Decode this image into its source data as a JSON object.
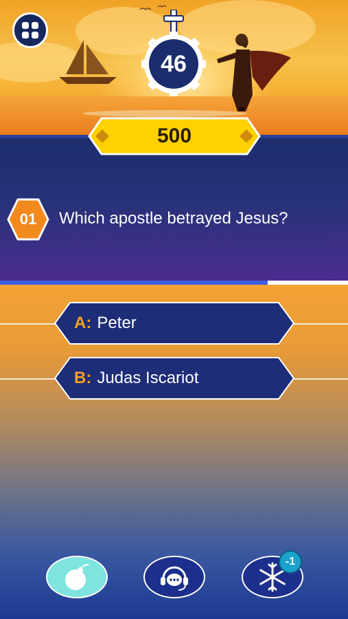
{
  "timer": {
    "value": "46"
  },
  "score": {
    "value": "500"
  },
  "question": {
    "number": "01",
    "text": "Which apostle betrayed Jesus?"
  },
  "progress": {
    "fraction": 0.77
  },
  "answers": [
    {
      "letter": "A:",
      "text": "Peter"
    },
    {
      "letter": "B:",
      "text": "Judas Iscariot"
    }
  ],
  "powerups": {
    "bomb": {
      "icon": "bomb-icon"
    },
    "help": {
      "icon": "headset-chat-icon"
    },
    "freeze": {
      "icon": "snowflake-icon",
      "badge": "-1"
    }
  },
  "colors": {
    "accent_orange": "#f6a11f",
    "score_yellow": "#ffd100",
    "navy": "#1c2d6e",
    "progress_blue": "#3c5fe0"
  }
}
